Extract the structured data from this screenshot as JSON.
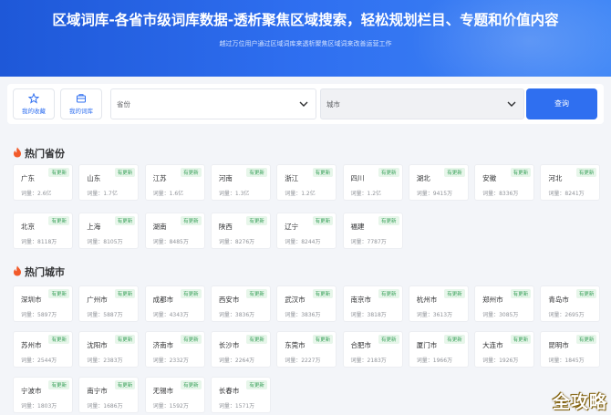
{
  "hero": {
    "title": "区域词库-各省市级词库数据-透析聚焦区域搜索，轻松规划栏目、专题和价值内容",
    "subtitle": "越过万位用户通过区域词库来透析聚焦区域词来改善运营工作"
  },
  "search": {
    "favorites_label": "我的收藏",
    "my_lexicon_label": "我的词库",
    "province_value": "省份",
    "city_value": "城市",
    "query_label": "查询"
  },
  "hot_provinces": {
    "title": "热门省份",
    "items": [
      {
        "name": "广东",
        "badge": "有更新",
        "count": "词量：2.6亿"
      },
      {
        "name": "山东",
        "badge": "有更新",
        "count": "词量：1.7亿"
      },
      {
        "name": "江苏",
        "badge": "有更新",
        "count": "词量：1.6亿"
      },
      {
        "name": "河南",
        "badge": "有更新",
        "count": "词量：1.3亿"
      },
      {
        "name": "浙江",
        "badge": "有更新",
        "count": "词量：1.2亿"
      },
      {
        "name": "四川",
        "badge": "有更新",
        "count": "词量：1.2亿"
      },
      {
        "name": "湖北",
        "badge": "有更新",
        "count": "词量：9415万"
      },
      {
        "name": "安徽",
        "badge": "有更新",
        "count": "词量：8336万"
      },
      {
        "name": "河北",
        "badge": "有更新",
        "count": "词量：8241万"
      },
      {
        "name": "北京",
        "badge": "有更新",
        "count": "词量：8118万"
      },
      {
        "name": "上海",
        "badge": "有更新",
        "count": "词量：8105万"
      },
      {
        "name": "湖南",
        "badge": "有更新",
        "count": "词量：8485万"
      },
      {
        "name": "陕西",
        "badge": "有更新",
        "count": "词量：8276万"
      },
      {
        "name": "辽宁",
        "badge": "有更新",
        "count": "词量：8244万"
      },
      {
        "name": "福建",
        "badge": "有更新",
        "count": "词量：7787万"
      }
    ]
  },
  "hot_cities": {
    "title": "热门城市",
    "items": [
      {
        "name": "深圳市",
        "badge": "有更新",
        "count": "词量：5897万"
      },
      {
        "name": "广州市",
        "badge": "有更新",
        "count": "词量：5887万"
      },
      {
        "name": "成都市",
        "badge": "有更新",
        "count": "词量：4343万"
      },
      {
        "name": "西安市",
        "badge": "有更新",
        "count": "词量：3836万"
      },
      {
        "name": "武汉市",
        "badge": "有更新",
        "count": "词量：3836万"
      },
      {
        "name": "南京市",
        "badge": "有更新",
        "count": "词量：3818万"
      },
      {
        "name": "杭州市",
        "badge": "有更新",
        "count": "词量：3613万"
      },
      {
        "name": "郑州市",
        "badge": "有更新",
        "count": "词量：3085万"
      },
      {
        "name": "青岛市",
        "badge": "有更新",
        "count": "词量：2695万"
      },
      {
        "name": "苏州市",
        "badge": "有更新",
        "count": "词量：2544万"
      },
      {
        "name": "沈阳市",
        "badge": "有更新",
        "count": "词量：2383万"
      },
      {
        "name": "济南市",
        "badge": "有更新",
        "count": "词量：2332万"
      },
      {
        "name": "长沙市",
        "badge": "有更新",
        "count": "词量：2264万"
      },
      {
        "name": "东莞市",
        "badge": "有更新",
        "count": "词量：2227万"
      },
      {
        "name": "合肥市",
        "badge": "有更新",
        "count": "词量：2183万"
      },
      {
        "name": "厦门市",
        "badge": "有更新",
        "count": "词量：1966万"
      },
      {
        "name": "大连市",
        "badge": "有更新",
        "count": "词量：1926万"
      },
      {
        "name": "昆明市",
        "badge": "有更新",
        "count": "词量：1845万"
      },
      {
        "name": "宁波市",
        "badge": "有更新",
        "count": "词量：1803万"
      },
      {
        "name": "南宁市",
        "badge": "有更新",
        "count": "词量：1686万"
      },
      {
        "name": "无锡市",
        "badge": "有更新",
        "count": "词量：1592万"
      },
      {
        "name": "长春市",
        "badge": "有更新",
        "count": "词量：1571万"
      }
    ]
  },
  "watermark": "全攻略",
  "colors": {
    "primary": "#2f6ff0",
    "badge_text": "#3aa15b",
    "badge_bg": "#e7f6ea",
    "fire": "#f25a2a"
  }
}
